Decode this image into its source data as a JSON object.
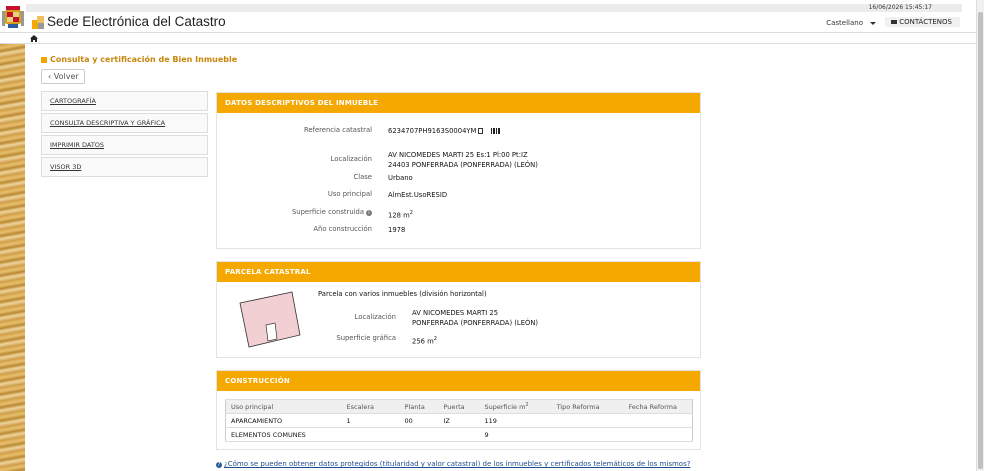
{
  "datetime": "16/06/2026  15:45:17",
  "header": {
    "title": "Sede Electrónica del Catastro",
    "language": "Castellano",
    "contact_label": "CONTÁCTENOS"
  },
  "page": {
    "title": "Consulta y certificación de Bien Inmueble",
    "back_label": "Volver"
  },
  "sidebar": {
    "items": [
      {
        "label": "CARTOGRAFÍA"
      },
      {
        "label": "CONSULTA DESCRIPTIVA Y GRÁFICA"
      },
      {
        "label": "IMPRIMIR DATOS"
      },
      {
        "label": "VISOR 3D"
      }
    ]
  },
  "datos": {
    "heading": "DATOS DESCRIPTIVOS DEL INMUEBLE",
    "ref_label": "Referencia catastral",
    "ref_value": "6234707PH9163S0004YM",
    "loc_label": "Localización",
    "loc_line1": "AV NICOMEDES MARTI 25 Es:1 Pl:00 Pt:IZ",
    "loc_line2": "24403 PONFERRADA (PONFERRADA) (LEÓN)",
    "clase_label": "Clase",
    "clase_value": "Urbano",
    "uso_label": "Uso principal",
    "uso_value": "AlmEst.UsoRESID",
    "sup_label": "Superficie construida",
    "sup_value": "128 m",
    "anio_label": "Año construcción",
    "anio_value": "1978"
  },
  "parcela": {
    "heading": "PARCELA CATASTRAL",
    "description": "Parcela con varios inmuebles (división horizontal)",
    "loc_label": "Localización",
    "loc_line1": "AV NICOMEDES MARTI 25",
    "loc_line2": "PONFERRADA (PONFERRADA) (LEÓN)",
    "sup_label": "Superficie gráfica",
    "sup_value": "256 m"
  },
  "construccion": {
    "heading": "CONSTRUCCIÓN",
    "columns": [
      "Uso principal",
      "Escalera",
      "Planta",
      "Puerta",
      "Superficie m",
      "Tipo Reforma",
      "Fecha Reforma"
    ],
    "rows": [
      [
        "APARCAMIENTO",
        "1",
        "00",
        "IZ",
        "119",
        "",
        ""
      ],
      [
        "ELEMENTOS COMUNES",
        "",
        "",
        "",
        "9",
        "",
        ""
      ]
    ]
  },
  "faq": "¿Cómo se pueden obtener datos protegidos (titularidad y valor catastral) de los inmuebles y certificados telemáticos de los mismos?",
  "colors": {
    "accent": "#f5a800",
    "title": "#c8860a",
    "link": "#1f4e8f"
  }
}
